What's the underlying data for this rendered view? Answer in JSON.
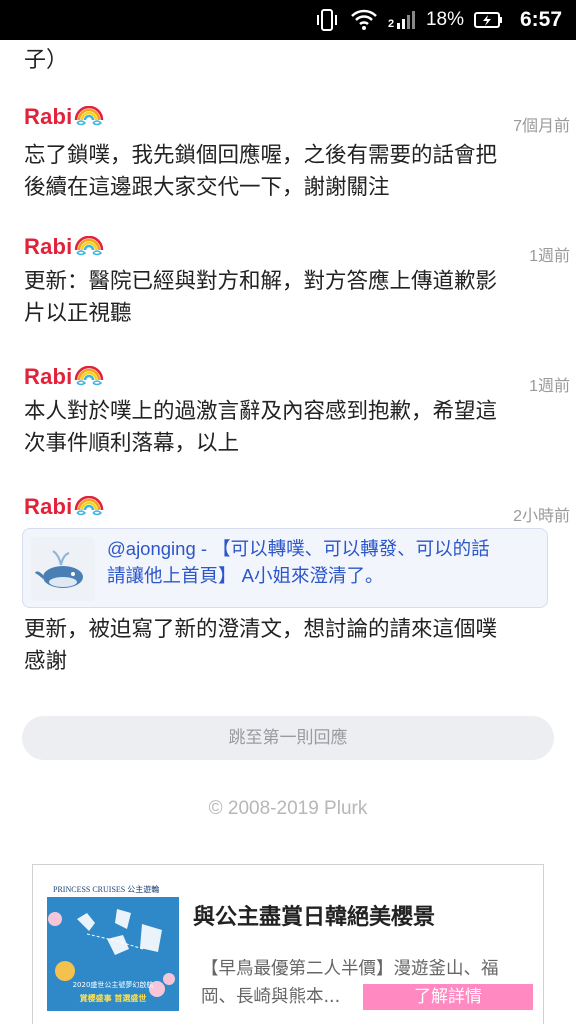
{
  "status_bar": {
    "battery": "18%",
    "time": "6:57",
    "icons": [
      "vibrate-icon",
      "wifi-icon",
      "signal-icon",
      "battery-charging-icon"
    ]
  },
  "previous_tail": "子）",
  "responses": [
    {
      "author": "Rabi",
      "time": "7個月前",
      "text_lines": [
        "忘了鎖噗，我先鎖個回應喔，之後有需要的話會把",
        "後續在這邊跟大家交代一下，謝謝關注"
      ]
    },
    {
      "author": "Rabi",
      "time": "1週前",
      "text_lines": [
        "更新：醫院已經與對方和解，對方答應上傳道歉影",
        "片以正視聽"
      ]
    },
    {
      "author": "Rabi",
      "time": "1週前",
      "text_lines": [
        "本人對於噗上的過激言辭及內容感到抱歉，希望這",
        "次事件順利落幕，以上"
      ]
    },
    {
      "author": "Rabi",
      "time": "2小時前",
      "quote": {
        "line1": "@ajonging - 【可以轉噗、可以轉發、可以的話",
        "line2": "請讓他上首頁】 A小姐來澄清了。"
      },
      "text_lines": [
        "更新，被迫寫了新的澄清文，想討論的請來這個噗",
        "感謝"
      ]
    }
  ],
  "jump_button": "跳至第一則回應",
  "copyright": "© 2008-2019 Plurk",
  "ad": {
    "image_brand": "PRINCESS CRUISES 公主遊輪",
    "image_caption": "2020盛世公主號夢幻啟航",
    "image_slogan": "賞櫻盛事 首選盛世",
    "title": "與公主盡賞日韓絕美櫻景",
    "desc_lines": [
      "【早鳥最優第二人半價】漫遊釜山、福",
      "岡、長崎與熊本..."
    ],
    "cta": "了解詳情"
  },
  "colors": {
    "logo_red": "#e2213a",
    "link_blue": "#2b57c9",
    "cta_pink": "#ff89c0"
  }
}
